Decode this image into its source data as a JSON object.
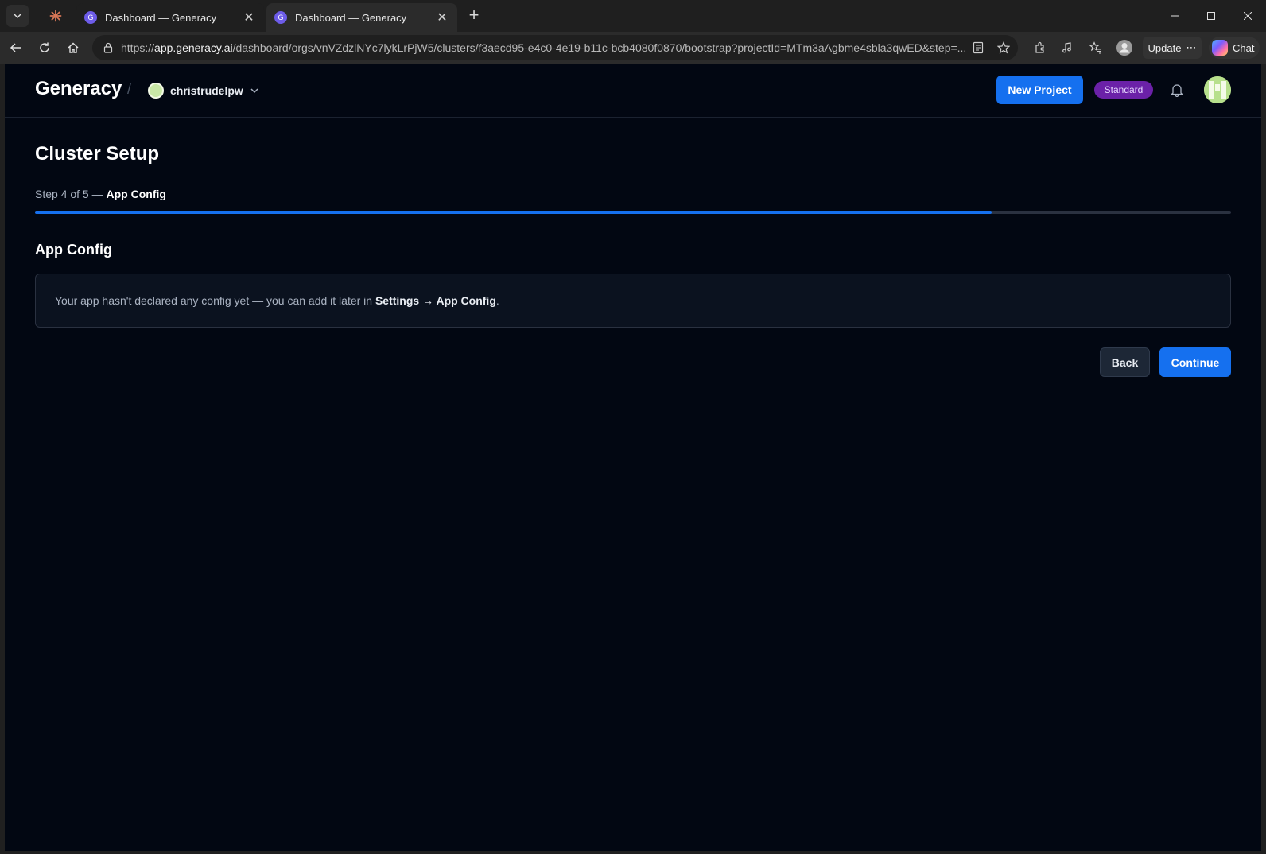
{
  "browser": {
    "tabs": [
      {
        "title": "Dashboard — Generacy",
        "favicon": "G",
        "active": false
      },
      {
        "title": "Dashboard — Generacy",
        "favicon": "G",
        "active": true
      }
    ],
    "url_host": "app.generacy.ai",
    "url_scheme": "https://",
    "url_path": "/dashboard/orgs/vnVZdzlNYc7lykLrPjW5/clusters/f3aecd95-e4c0-4e19-b11c-bcb4080f0870/bootstrap?projectId=MTm3aAgbme4sbla3qwED&step=...",
    "update_label": "Update",
    "chat_label": "Chat"
  },
  "header": {
    "brand": "Generacy",
    "separator": "/",
    "org_name": "christrudelpw",
    "new_project_label": "New Project",
    "plan_badge": "Standard"
  },
  "main": {
    "title": "Cluster Setup",
    "step_prefix": "Step 4 of 5 —",
    "step_name": "App Config",
    "progress": {
      "current": 4,
      "total": 5,
      "fraction": 0.8
    },
    "section_title": "App Config",
    "info_text_before": "Your app hasn't declared any config yet — you can add it later in ",
    "info_link": "Settings → App Config",
    "info_text_after": ".",
    "back_label": "Back",
    "continue_label": "Continue"
  },
  "colors": {
    "accent": "#1570ef",
    "page_bg": "#020712",
    "badge_bg": "#6b21a8"
  }
}
